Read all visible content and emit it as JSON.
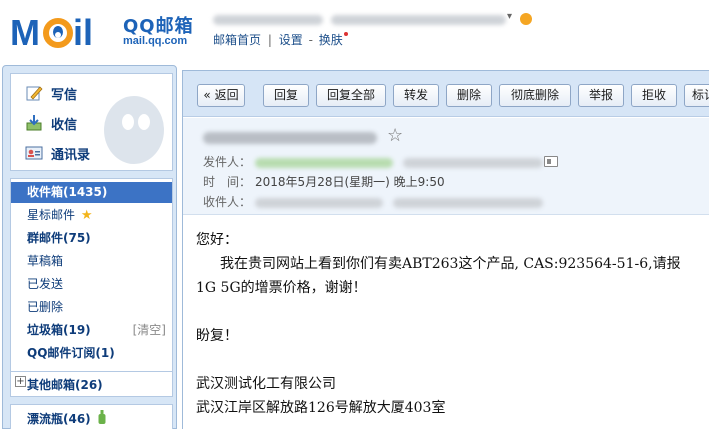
{
  "header": {
    "brand_cn": "QQ邮箱",
    "brand_url": "mail.qq.com",
    "links": {
      "home": "邮箱首页",
      "settings": "设置",
      "skin": "换肤",
      "separator": "|",
      "dash": "-"
    },
    "dropdown_glyph": "▾"
  },
  "sidebar": {
    "quick": [
      {
        "icon": "pencil-icon",
        "label": "写信"
      },
      {
        "icon": "inbox-download-icon",
        "label": "收信"
      },
      {
        "icon": "contacts-card-icon",
        "label": "通讯录"
      }
    ],
    "folders": [
      {
        "label": "收件箱(1435)",
        "active": true,
        "bold": true
      },
      {
        "label": "星标邮件",
        "icon": "star-icon",
        "bold": false
      },
      {
        "label": "群邮件(75)",
        "bold": true
      },
      {
        "label": "草稿箱",
        "bold": false
      },
      {
        "label": "已发送",
        "bold": false
      },
      {
        "label": "已删除",
        "bold": false
      },
      {
        "label": "垃圾箱(19)",
        "bold": true,
        "action": "[清空]"
      },
      {
        "label": "QQ邮件订阅(1)",
        "bold": true
      }
    ],
    "other": {
      "expand": "+",
      "label": "其他邮箱(26)"
    },
    "drift": {
      "label": "漂流瓶(46)",
      "icon": "bottle-icon"
    }
  },
  "toolbar": {
    "buttons": [
      "« 返回",
      "回复",
      "回复全部",
      "转发",
      "删除",
      "彻底删除",
      "举报",
      "拒收",
      "标记"
    ]
  },
  "message": {
    "star": "☆",
    "from_label": "发件人：",
    "time_label": "时　间：",
    "time_value": "2018年5月28日(星期一) 晚上9:50",
    "to_label": "收件人：",
    "body": {
      "greeting": "您好：",
      "line1": "我在贵司网站上看到你们有卖ABT263这个产品, CAS:923564-51-6,请报",
      "line2": "1G 5G的增票价格，谢谢！",
      "closing": "盼复！",
      "company": "武汉测试化工有限公司",
      "address": "武汉江岸区解放路126号解放大厦403室"
    }
  },
  "colors": {
    "brand_blue": "#1d63b8",
    "active_folder_bg": "#3c73c5",
    "sidebar_bg": "#d7e6f6",
    "toolbar_bg": "#d6e5f6",
    "header_bg": "#eef4fb"
  }
}
